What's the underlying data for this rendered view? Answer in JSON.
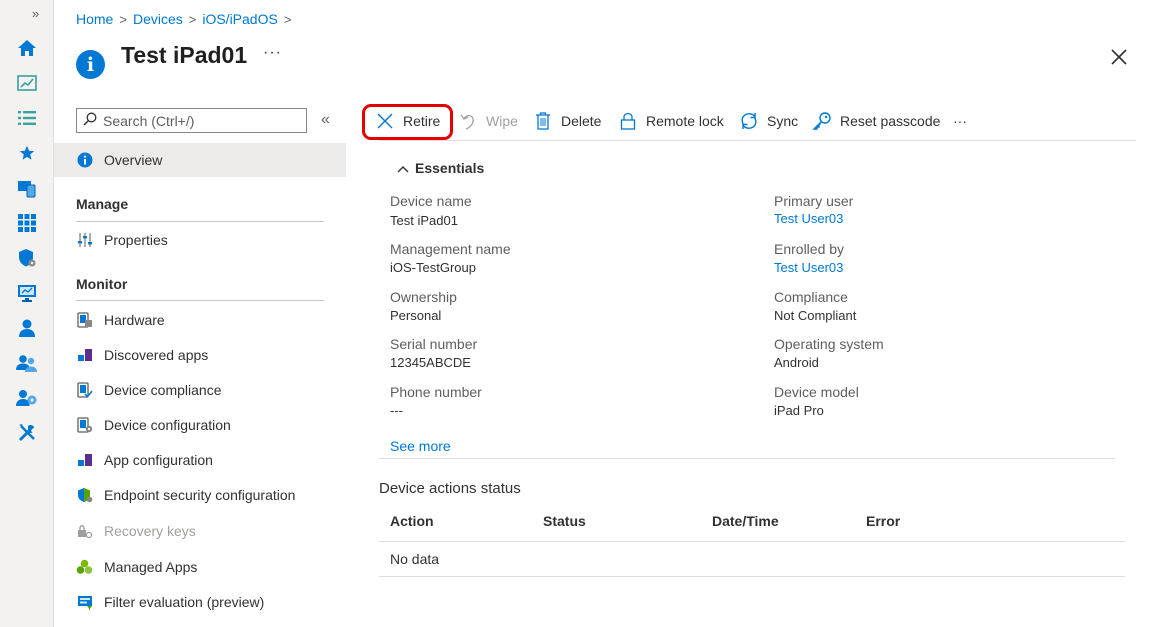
{
  "breadcrumb": [
    "Home",
    "Devices",
    "iOS/iPadOS"
  ],
  "page": {
    "title": "Test iPad01",
    "more": "···"
  },
  "search": {
    "placeholder": "Search (Ctrl+/)"
  },
  "menu": {
    "overview": "Overview",
    "manage_header": "Manage",
    "properties": "Properties",
    "monitor_header": "Monitor",
    "monitor_items": [
      "Hardware",
      "Discovered apps",
      "Device compliance",
      "Device configuration",
      "App configuration",
      "Endpoint security configuration",
      "Recovery keys",
      "Managed Apps",
      "Filter evaluation (preview)"
    ]
  },
  "toolbar": {
    "retire": "Retire",
    "wipe": "Wipe",
    "delete": "Delete",
    "remote_lock": "Remote lock",
    "sync": "Sync",
    "reset_passcode": "Reset passcode",
    "more": "···"
  },
  "essentials": {
    "header": "Essentials",
    "left": [
      {
        "label": "Device name",
        "value": "Test iPad01"
      },
      {
        "label": "Management name",
        "value": "iOS-TestGroup"
      },
      {
        "label": "Ownership",
        "value": "Personal"
      },
      {
        "label": "Serial number",
        "value": "12345ABCDE"
      },
      {
        "label": "Phone number",
        "value": "---"
      }
    ],
    "right": [
      {
        "label": "Primary user",
        "value": "Test User03"
      },
      {
        "label": "Enrolled by",
        "value": "Test User03"
      },
      {
        "label": "Compliance",
        "value": "Not Compliant"
      },
      {
        "label": "Operating system",
        "value": "Android"
      },
      {
        "label": "Device model",
        "value": "iPad Pro"
      }
    ],
    "see_more": "See more"
  },
  "actions_status": {
    "title": "Device actions status",
    "columns": [
      "Action",
      "Status",
      "Date/Time",
      "Error"
    ],
    "empty": "No data"
  },
  "colors": {
    "accent": "#0078d4",
    "highlight": "#e30000"
  }
}
